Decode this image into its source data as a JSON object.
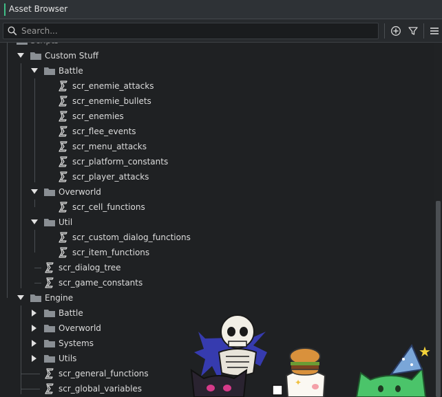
{
  "window": {
    "title": "Asset Browser"
  },
  "toolbar": {
    "search_placeholder": "Search...",
    "icons": [
      "search-icon",
      "add-icon",
      "filter-icon",
      "menu-icon"
    ]
  },
  "tree": {
    "partial_top_label": "Scripts",
    "rows": [
      {
        "label": "Custom Stuff",
        "kind": "folder",
        "expanded": true
      },
      {
        "label": "Battle",
        "kind": "folder",
        "expanded": true
      },
      {
        "label": "scr_enemie_attacks",
        "kind": "script"
      },
      {
        "label": "scr_enemie_bullets",
        "kind": "script"
      },
      {
        "label": "scr_enemies",
        "kind": "script"
      },
      {
        "label": "scr_flee_events",
        "kind": "script"
      },
      {
        "label": "scr_menu_attacks",
        "kind": "script"
      },
      {
        "label": "scr_platform_constants",
        "kind": "script"
      },
      {
        "label": "scr_player_attacks",
        "kind": "script"
      },
      {
        "label": "Overworld",
        "kind": "folder",
        "expanded": true
      },
      {
        "label": "scr_cell_functions",
        "kind": "script"
      },
      {
        "label": "Util",
        "kind": "folder",
        "expanded": true
      },
      {
        "label": "scr_custom_dialog_functions",
        "kind": "script"
      },
      {
        "label": "scr_item_functions",
        "kind": "script"
      },
      {
        "label": "scr_dialog_tree",
        "kind": "script"
      },
      {
        "label": "scr_game_constants",
        "kind": "script"
      },
      {
        "label": "Engine",
        "kind": "folder",
        "expanded": true
      },
      {
        "label": "Battle",
        "kind": "folder",
        "expanded": false
      },
      {
        "label": "Overworld",
        "kind": "folder",
        "expanded": false
      },
      {
        "label": "Systems",
        "kind": "folder",
        "expanded": false
      },
      {
        "label": "Utils",
        "kind": "folder",
        "expanded": false
      },
      {
        "label": "scr_general_functions",
        "kind": "script"
      },
      {
        "label": "scr_global_variables",
        "kind": "script"
      }
    ]
  },
  "colors": {
    "background": "#1f2123",
    "titlebar": "#2e3236",
    "accent": "#3fbf87",
    "text": "#dcdcdc",
    "guide": "#4a4e52",
    "folder": "#8a8f94"
  }
}
